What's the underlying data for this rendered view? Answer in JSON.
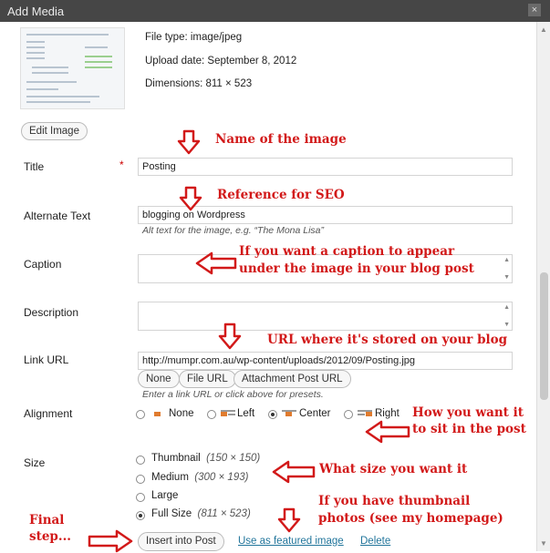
{
  "window": {
    "title": "Add Media",
    "close": "×"
  },
  "file": {
    "type_label": "File type:",
    "type_value": "image/jpeg",
    "date_label": "Upload date:",
    "date_value": "September 8, 2012",
    "dim_label": "Dimensions:",
    "dim_value": "811 × 523"
  },
  "edit_image_label": "Edit Image",
  "fields": {
    "title_label": "Title",
    "title_required": "*",
    "title_value": "Posting",
    "alt_label": "Alternate Text",
    "alt_value": "blogging on Wordpress",
    "alt_help": "Alt text for the image, e.g. “The Mona Lisa”",
    "caption_label": "Caption",
    "description_label": "Description",
    "link_label": "Link URL",
    "link_value": "http://mumpr.com.au/wp-content/uploads/2012/09/Posting.jpg",
    "link_help": "Enter a link URL or click above for presets."
  },
  "link_buttons": {
    "none": "None",
    "file": "File URL",
    "attachment": "Attachment Post URL"
  },
  "alignment": {
    "label": "Alignment",
    "options": [
      {
        "label": "None",
        "selected": false
      },
      {
        "label": "Left",
        "selected": false
      },
      {
        "label": "Center",
        "selected": true
      },
      {
        "label": "Right",
        "selected": false
      }
    ]
  },
  "size": {
    "label": "Size",
    "options": [
      {
        "label": "Thumbnail",
        "dim": "(150 × 150)",
        "selected": false
      },
      {
        "label": "Medium",
        "dim": "(300 × 193)",
        "selected": false
      },
      {
        "label": "Large",
        "dim": "",
        "selected": false
      },
      {
        "label": "Full Size",
        "dim": "(811 × 523)",
        "selected": true
      }
    ]
  },
  "actions": {
    "insert": "Insert into Post",
    "featured": "Use as featured image",
    "delete": "Delete"
  },
  "annotations": {
    "name": "Name of the image",
    "seo": "Reference for SEO",
    "caption_1": "If you want a caption to appear",
    "caption_2": "under the image in your blog post",
    "url": "URL where it's stored on your blog",
    "sit_1": "How you want it",
    "sit_2": "to sit in the post",
    "size": "What size you want it",
    "thumb_1": "If you have thumbnail",
    "thumb_2": "photos (see my homepage)",
    "final_1": "Final",
    "final_2": "step..."
  },
  "colors": {
    "annotation": "#d21919",
    "link": "#21759b",
    "titlebar": "#464646"
  }
}
